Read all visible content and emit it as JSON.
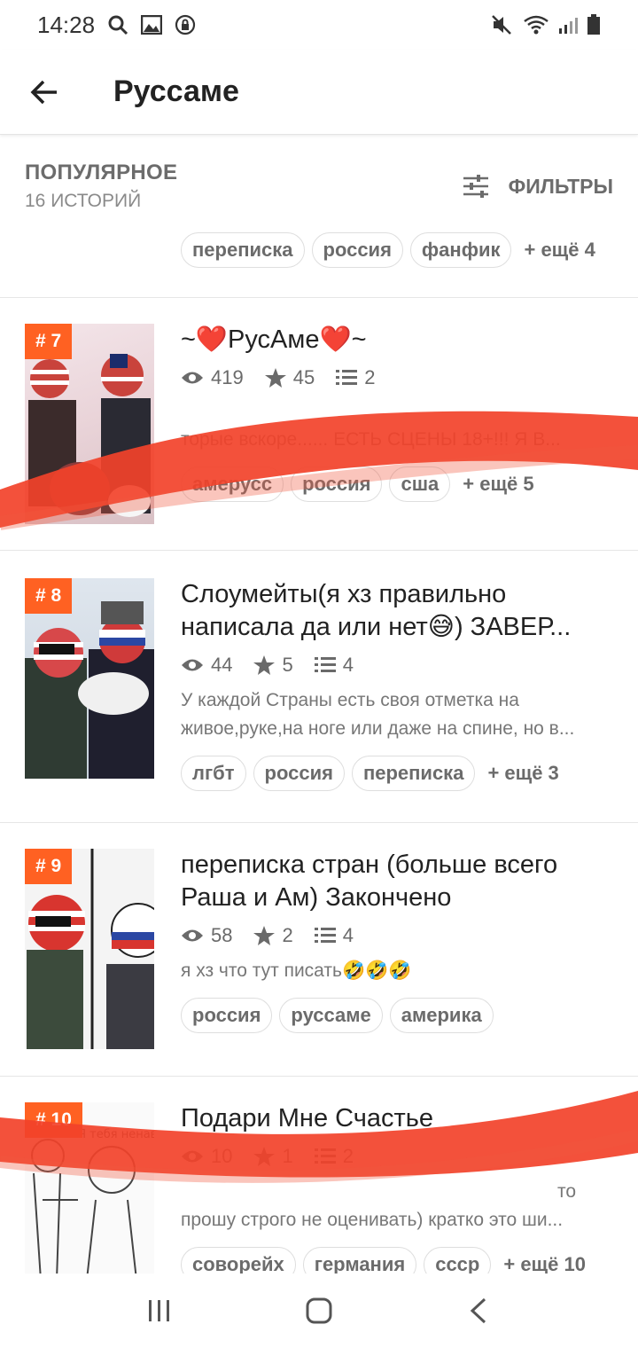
{
  "status_bar": {
    "time": "14:28"
  },
  "header": {
    "title": "Руссаме"
  },
  "section": {
    "sort_label": "ПОПУЛЯРНОЕ",
    "count": "16 ИСТОРИЙ",
    "filters_label": "ФИЛЬТРЫ"
  },
  "previous_tags": [
    "переписка",
    "россия",
    "фанфик"
  ],
  "previous_more": "+ ещё 4",
  "stories": [
    {
      "rank": "# 7",
      "title": "~❤️РусАме❤️~",
      "views": "419",
      "stars": "45",
      "parts": "2",
      "desc": [
        "торые вскоре...... ЕСТЬ СЦЕНЫ 18+!!! Я В..."
      ],
      "tags": [
        "амерусс",
        "россия",
        "сша"
      ],
      "more": "+ ещё 5"
    },
    {
      "rank": "# 8",
      "title": "Слоумейты(я хз правильно написала да или нет😅) ЗАВЕР...",
      "views": "44",
      "stars": "5",
      "parts": "4",
      "desc": [
        "У каждой Страны есть своя отметка на",
        "живое,руке,на ноге или даже на спине, но в..."
      ],
      "tags": [
        "лгбт",
        "россия",
        "переписка"
      ],
      "more": "+ ещё 3"
    },
    {
      "rank": "# 9",
      "title": "переписка стран (больше всего Раша и Ам) Закончено",
      "views": "58",
      "stars": "2",
      "parts": "4",
      "desc": [
        "я хз что тут писать🤣🤣🤣"
      ],
      "tags": [
        "россия",
        "руссаме",
        "америка"
      ],
      "more": ""
    },
    {
      "rank": "# 10",
      "title": "Подари Мне Счастье",
      "views": "10",
      "stars": "1",
      "parts": "2",
      "desc": [
        "то",
        "прошу строго не оценивать) кратко это ши..."
      ],
      "tags": [
        "соворейх",
        "германия",
        "ссср"
      ],
      "more": "+ ещё 10"
    }
  ],
  "covers": [
    "Я тебя ненавиж"
  ]
}
